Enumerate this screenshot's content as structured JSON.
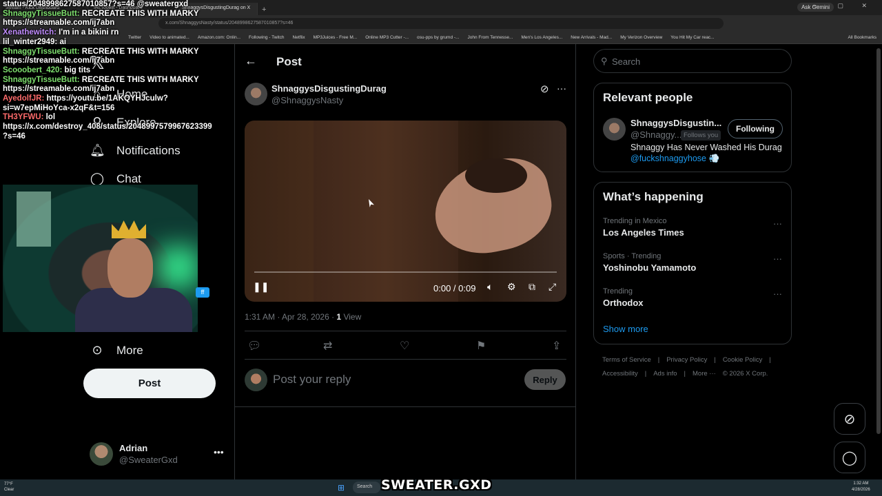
{
  "browser": {
    "tabs": [
      "Stream - Kick Dashboard",
      "IRLToolkit - Dashboard",
      "ShnaggysDisgustingDurag on X"
    ],
    "new_tab": "+",
    "gemini": "Ask Gemini",
    "window_buttons": "—  ▢  ✕",
    "url": "x.com/ShnaggysNasty/status/2048998627587010857?s=46",
    "bookmarks": [
      "Twitter",
      "Video to animated...",
      "Amazon.com: Onlin...",
      "Following - Twitch",
      "Netflix",
      "MP3Juices - Free M...",
      "Online MP3 Cutter -...",
      "osu-pps by grumd -...",
      "John From Tennesse...",
      "Men's Los Angeles...",
      "New Arrivals - Mad...",
      "My Verizon Overview",
      "You Hit My Car reac..."
    ],
    "all_bookmarks": "All Bookmarks"
  },
  "chat": [
    {
      "user": "",
      "msg": "status/2048998627587010857?s=46 @sweatergxd",
      "cls": ""
    },
    {
      "user": "ShnaggyTissueButt:",
      "msg": " RECREATE THIS WITH MARKY",
      "cls": "u"
    },
    {
      "user": "",
      "msg": "https://streamable.com/ij7abn",
      "cls": ""
    },
    {
      "user": "Xenathewitch:",
      "msg": " I'm in a bikini rn",
      "cls": "u4"
    },
    {
      "user": "lil_winter2949:",
      "msg": " ai",
      "cls": ""
    },
    {
      "user": "ShnaggyTissueButt:",
      "msg": " RECREATE THIS WITH MARKY",
      "cls": "u"
    },
    {
      "user": "",
      "msg": "https://streamable.com/ij7abn",
      "cls": ""
    },
    {
      "user": "Scooobert_420:",
      "msg": " big tits",
      "cls": "u"
    },
    {
      "user": "ShnaggyTissueButt:",
      "msg": " RECREATE THIS WITH MARKY",
      "cls": "u"
    },
    {
      "user": "",
      "msg": "https://streamable.com/ij7abn",
      "cls": ""
    },
    {
      "user": "AyedolfJR:",
      "msg": " https://youtu.be/1AKQYHJculw?",
      "cls": "u3"
    },
    {
      "user": "",
      "msg": "si=w7epMiHoYca-x2qF&t=156",
      "cls": ""
    },
    {
      "user": "TH3YFWU:",
      "msg": " lol",
      "cls": "u3"
    },
    {
      "user": "",
      "msg": "https://x.com/destroy_408/status/2048997579967623399",
      "cls": ""
    },
    {
      "user": "",
      "msg": "?s=46",
      "cls": ""
    }
  ],
  "nav": {
    "items": [
      {
        "label": "Home",
        "icon": "home-icon",
        "glyph": "⌂"
      },
      {
        "label": "Explore",
        "icon": "search-icon",
        "glyph": "⚲"
      },
      {
        "label": "Notifications",
        "icon": "bell-icon",
        "glyph": "🔔︎"
      },
      {
        "label": "Chat",
        "icon": "chat-icon",
        "glyph": "◯"
      },
      {
        "label": "More",
        "icon": "more-circle-icon",
        "glyph": "⊙"
      }
    ],
    "post_button": "Post",
    "cam_badge": "ff"
  },
  "account": {
    "name": "Adrian",
    "handle": "@SweaterGxd"
  },
  "post": {
    "header": "Post",
    "author_name": "ShnaggysDisgustingDurag",
    "author_handle": "@ShnaggysNasty",
    "video_time": "0:00 / 0:09",
    "progress": 0.0,
    "time": "1:31 AM · Apr 28, 2026 · ",
    "views_count": "1",
    "views_label": " View",
    "reply_placeholder": "Post your reply",
    "reply_button": "Reply"
  },
  "search": {
    "placeholder": "Search"
  },
  "relevant": {
    "title": "Relevant people",
    "name": "ShnaggysDisgustin...",
    "handle": "@Shnaggy...",
    "follows_you": "Follows you",
    "button": "Following",
    "bio": "Shnaggy Has Never Washed His Durag",
    "link": "@fuckshnaggyhose 💨"
  },
  "happening": {
    "title": "What’s happening",
    "trends": [
      {
        "meta": "Trending in Mexico",
        "name": "Los Angeles Times"
      },
      {
        "meta": "Sports · Trending",
        "name": "Yoshinobu Yamamoto"
      },
      {
        "meta": "Trending",
        "name": "Orthodox"
      }
    ],
    "show_more": "Show more"
  },
  "footer": {
    "line1": [
      "Terms of Service",
      "|",
      "Privacy Policy",
      "|",
      "Cookie Policy",
      "|"
    ],
    "line2": [
      "Accessibility",
      "|",
      "Ads info",
      "|",
      "More ···",
      "© 2026 X Corp."
    ]
  },
  "taskbar": {
    "temp": "77°F",
    "cond": "Clear",
    "search": "Search",
    "brand": "SWEATER.GXD",
    "time": "1:32 AM",
    "date": "4/28/2026"
  }
}
